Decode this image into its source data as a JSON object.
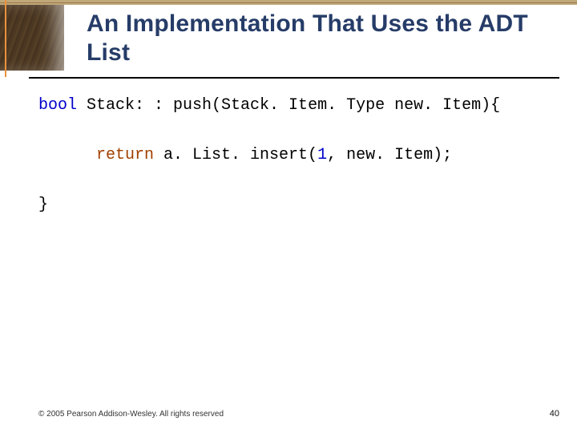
{
  "title": "An Implementation That Uses the ADT List",
  "code": {
    "line1_kw": "bool",
    "line1_rest": " Stack: : push(Stack. Item. Type new. Item){",
    "line2_ret": "return",
    "line2_mid": " a. List. insert(",
    "line2_num": "1",
    "line2_tail": ", new. Item);",
    "line3": "}"
  },
  "footer": {
    "left": "© 2005 Pearson Addison-Wesley. All rights reserved",
    "right": "40"
  }
}
